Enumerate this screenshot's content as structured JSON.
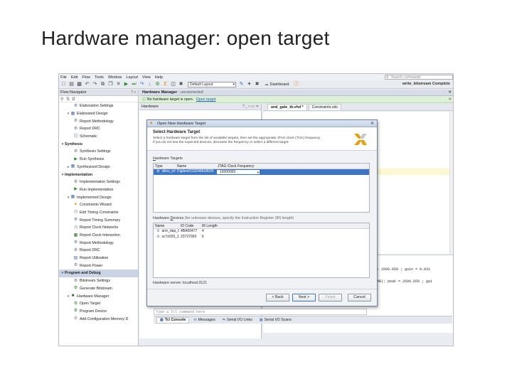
{
  "slide": {
    "title": "Hardware manager: open target"
  },
  "menu": {
    "items": [
      "File",
      "Edit",
      "Flow",
      "Tools",
      "Window",
      "Layout",
      "View",
      "Help"
    ],
    "search_placeholder": "Search commands"
  },
  "toolbar": {
    "layout_value": "Default Layout",
    "dashboard_label": "Dashboard",
    "status": "write_bitstream Complete"
  },
  "flow_navigator": {
    "title": "Flow Navigator",
    "items": [
      {
        "label": "Elaboration Settings",
        "kind": "item",
        "icon": "gear-icon"
      },
      {
        "label": "Elaborated Design",
        "kind": "group",
        "icon": "doc-icon"
      },
      {
        "label": "Report Methodology",
        "kind": "item",
        "icon": "gear-icon"
      },
      {
        "label": "Report DRC",
        "kind": "item",
        "icon": "gear-icon"
      },
      {
        "label": "Schematic",
        "kind": "item",
        "icon": "schematic-icon"
      },
      {
        "label": "Synthesis",
        "kind": "section",
        "icon": ""
      },
      {
        "label": "Synthesis Settings",
        "kind": "item",
        "icon": "gear-icon"
      },
      {
        "label": "Run Synthesis",
        "kind": "item",
        "icon": "play-icon"
      },
      {
        "label": "Synthesized Design",
        "kind": "group",
        "icon": "doc-icon"
      },
      {
        "label": "Implementation",
        "kind": "section",
        "icon": ""
      },
      {
        "label": "Implementation Settings",
        "kind": "item",
        "icon": "gear-icon"
      },
      {
        "label": "Run Implementation",
        "kind": "item",
        "icon": "play-icon"
      },
      {
        "label": "Implemented Design",
        "kind": "group",
        "icon": "doc-icon"
      },
      {
        "label": "Constraints Wizard",
        "kind": "item",
        "icon": "wizard-icon"
      },
      {
        "label": "Edit Timing Constraints",
        "kind": "item",
        "icon": "clock-icon"
      },
      {
        "label": "Report Timing Summary",
        "kind": "item",
        "icon": "gear-icon"
      },
      {
        "label": "Report Clock Networks",
        "kind": "item",
        "icon": "clock-icon"
      },
      {
        "label": "Report Clock Interaction",
        "kind": "item",
        "icon": "grid-icon"
      },
      {
        "label": "Report Methodology",
        "kind": "item",
        "icon": "gear-icon"
      },
      {
        "label": "Report DRC",
        "kind": "item",
        "icon": "gear-icon"
      },
      {
        "label": "Report Utilization",
        "kind": "item",
        "icon": "chart-icon"
      },
      {
        "label": "Report Power",
        "kind": "item",
        "icon": "gear-icon"
      },
      {
        "label": "Program and Debug",
        "kind": "section",
        "icon": ""
      },
      {
        "label": "Bitstream Settings",
        "kind": "item",
        "icon": "gear-icon"
      },
      {
        "label": "Generate Bitstream",
        "kind": "item",
        "icon": "bitstream-icon"
      },
      {
        "label": "Hardware Manager",
        "kind": "group",
        "icon": "chip-icon"
      },
      {
        "label": "Open Target",
        "kind": "item",
        "icon": "target-icon"
      },
      {
        "label": "Program Device",
        "kind": "item",
        "icon": "target-icon"
      },
      {
        "label": "Add Configuration Memory D",
        "kind": "item",
        "icon": "memory-icon"
      }
    ]
  },
  "hardware_manager": {
    "title": "Hardware Manager",
    "subtitle": "- unconnected",
    "notice": "No hardware target is open.",
    "notice_link": "Open target",
    "panel_title": "Hardware"
  },
  "editor": {
    "tabs": [
      "and_gate_tb.vhd *",
      "Constraints.xdc"
    ]
  },
  "tcl": {
    "lines": [
      ": 2600.859 ; gain = 0.031",
      "MB): peak = 2600.859 ; gai"
    ],
    "placeholder": "Type a Tcl command here",
    "tabs": [
      "Tcl Console",
      "Messages",
      "Serial I/O Links",
      "Serial I/O Scans"
    ]
  },
  "dialog": {
    "title": "Open New Hardware Target",
    "heading": "Select Hardware Target",
    "description": "Select a hardware target from the list of available targets, then set the appropriate JTAG clock (TCK) frequency. If you do not see the expected devices, decrease the frequency or select a different target.",
    "targets_label_u": "H",
    "targets_label": "ardware Targets",
    "targets_columns": [
      "Type",
      "Name",
      "JTAG Clock Frequency"
    ],
    "targets_rows": [
      {
        "type": "xilinx_tcf",
        "name": "Digilent/210248518625",
        "freq": "15000000"
      }
    ],
    "devices_label_pre": "Hardware ",
    "devices_label_u": "D",
    "devices_label_post": "evices",
    "devices_label_note": "(for unknown devices, specify the Instruction Register (IR) length)",
    "devices_columns": [
      "Name",
      "ID Code",
      "IR Length"
    ],
    "devices_rows": [
      {
        "name": "arm_dap_0",
        "id": "4BA00477",
        "ir": "4"
      },
      {
        "name": "xc7z020_1",
        "id": "23727093",
        "ir": "6"
      }
    ],
    "server": "Hardware server: localhost:3121",
    "buttons": {
      "back": "< Back",
      "next": "Next >",
      "finish": "Finish",
      "cancel": "Cancel"
    }
  }
}
